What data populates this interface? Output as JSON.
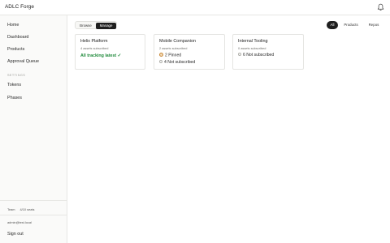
{
  "app": {
    "title": "ADLC Forge"
  },
  "sidebar": {
    "items": [
      {
        "label": "Home"
      },
      {
        "label": "Dashboard"
      },
      {
        "label": "Products"
      },
      {
        "label": "Approval Queue"
      }
    ],
    "settings_heading": "SETTINGS",
    "settings_items": [
      {
        "label": "Tokens"
      },
      {
        "label": "Phases"
      }
    ],
    "seats": {
      "plan": "Team",
      "usage": "4/10 seats"
    },
    "user_email": "admin@test.local",
    "sign_out": "Sign out"
  },
  "view_toggle": {
    "options": [
      "Browse",
      "Manage"
    ],
    "selected": "Manage"
  },
  "filters": {
    "options": [
      "All",
      "Products",
      "Repos"
    ],
    "selected": "All"
  },
  "cards": [
    {
      "name": "Helix Platform",
      "subtitle": "4 assets subscribed",
      "status": "All tracking latest",
      "status_check": "✓"
    },
    {
      "name": "Mobile Companion",
      "subtitle": "2 assets subscribed",
      "pinned": "2 Pinned",
      "not_subscribed": "4 Not subscribed"
    },
    {
      "name": "Internal Tooling",
      "subtitle": "0 assets subscribed",
      "not_subscribed": "6 Not subscribed"
    }
  ],
  "colors": {
    "accent_dark": "#1f1f1f",
    "status_green": "#1f8a3b",
    "pin_orange": "#c98a3a"
  },
  "icons": {
    "notifications": "bell-icon"
  }
}
